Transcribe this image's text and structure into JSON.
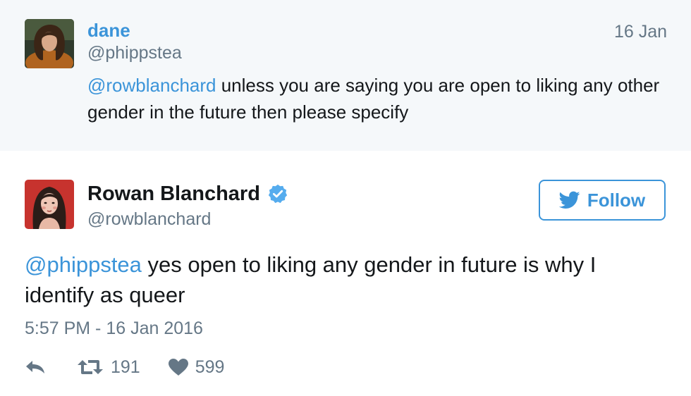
{
  "quoted_tweet": {
    "display_name": "dane",
    "handle": "@phippstea",
    "date": "16 Jan",
    "mention": "@rowblanchard",
    "text": " unless you are saying you are open to liking any other gender in the future then please specify"
  },
  "tweet": {
    "display_name": "Rowan Blanchard",
    "handle": "@rowblanchard",
    "verified": true,
    "follow_label": "Follow",
    "mention": "@phippstea",
    "text": " yes open to liking any gender in future is why I identify as queer",
    "timestamp": "5:57 PM - 16 Jan 2016",
    "retweet_count": "191",
    "like_count": "599"
  },
  "colors": {
    "link_blue": "#3b94d9",
    "muted_gray": "#657786",
    "quoted_bg": "#f5f8fa",
    "text_dark": "#14171a"
  },
  "icons": {
    "reply": "reply-arrow-icon",
    "retweet": "retweet-icon",
    "like": "heart-icon",
    "verified": "verified-badge-icon",
    "follow": "twitter-bird-icon"
  }
}
